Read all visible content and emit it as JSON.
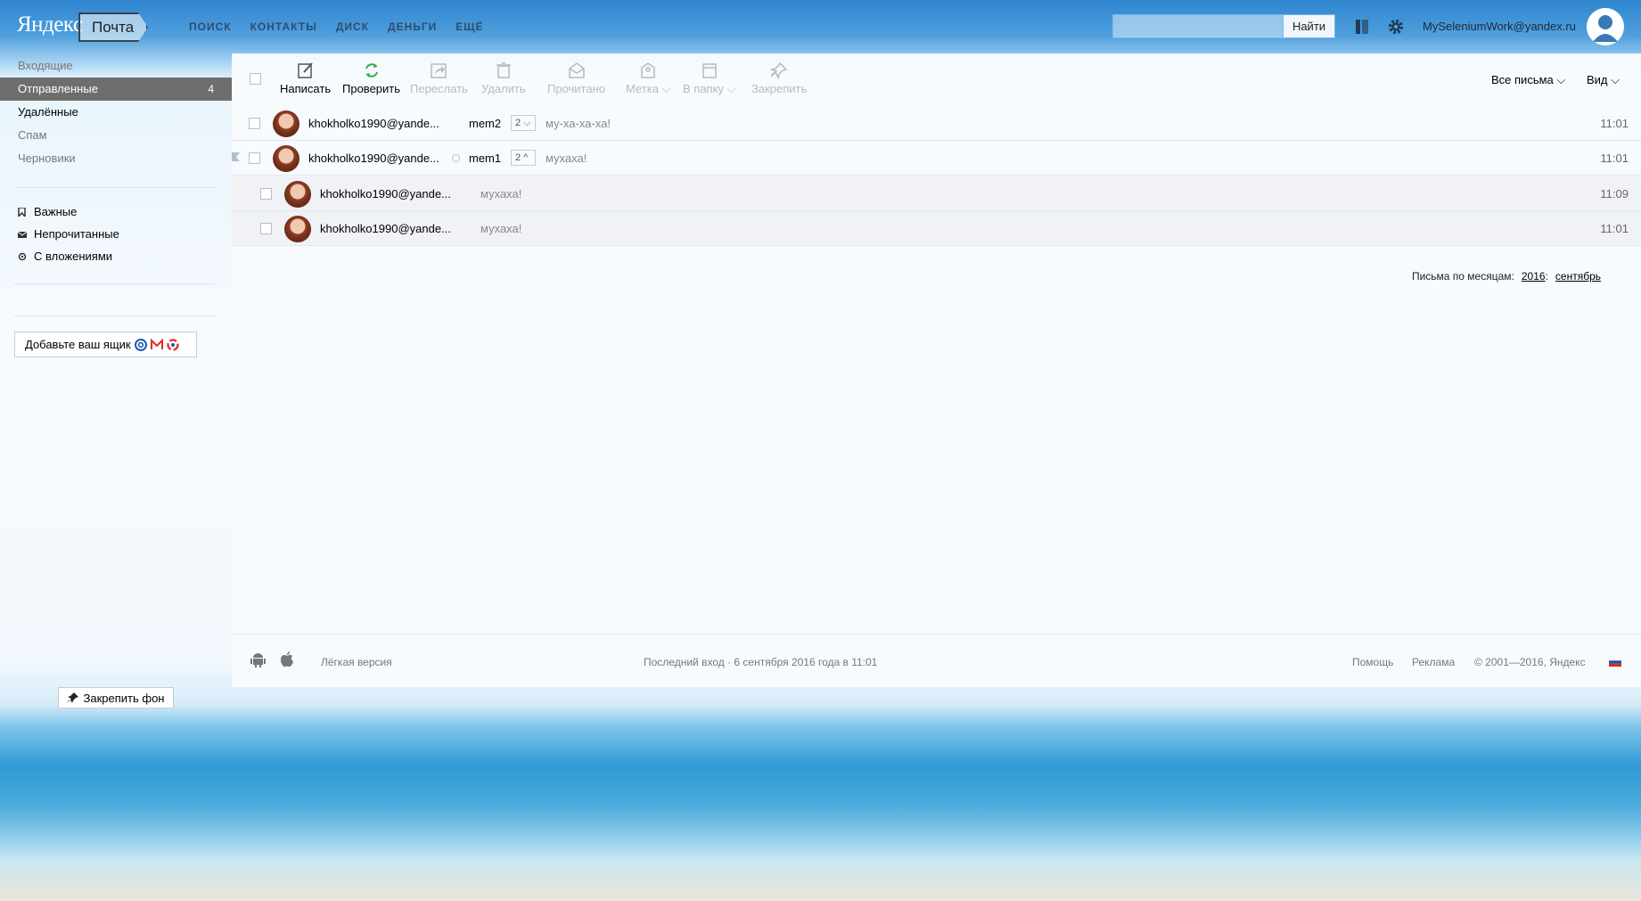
{
  "header": {
    "logo": "Яндекс",
    "mail_button": "Почта",
    "nav": [
      "ПОИСК",
      "КОНТАКТЫ",
      "ДИСК",
      "ДЕНЬГИ",
      "ЕЩЁ"
    ],
    "search_placeholder": "",
    "search_button": "Найти",
    "user_email": "MySeleniumWork@yandex.ru"
  },
  "sidebar": {
    "folders": [
      {
        "label": "Входящие",
        "count": ""
      },
      {
        "label": "Отправленные",
        "count": "4"
      },
      {
        "label": "Удалённые",
        "count": ""
      },
      {
        "label": "Спам",
        "count": ""
      },
      {
        "label": "Черновики",
        "count": ""
      }
    ],
    "labels": [
      {
        "label": "Важные",
        "icon": "bookmark-icon"
      },
      {
        "label": "Непрочитанные",
        "icon": "envelope-icon"
      },
      {
        "label": "С вложениями",
        "icon": "paperclip-icon"
      }
    ],
    "add_mailbox": "Добавьте ваш ящик",
    "pin_background": "Закрепить фон"
  },
  "toolbar": {
    "compose": "Написать",
    "check": "Проверить",
    "forward": "Переслать",
    "delete": "Удалить",
    "read": "Прочитано",
    "label": "Метка",
    "to_folder": "В папку",
    "pin": "Закрепить",
    "filter": "Все письма",
    "view": "Вид"
  },
  "messages": [
    {
      "from": "khokholko1990@yande...",
      "subject": "mem2",
      "count": "2",
      "snippet": "му-ха-ха-ха!",
      "time": "11:01"
    },
    {
      "from": "khokholko1990@yande...",
      "subject": "mem1",
      "count": "2",
      "snippet": "мухаха!",
      "time": "11:01"
    },
    {
      "from": "khokholko1990@yande...",
      "subject": "",
      "count": "",
      "snippet": "мухаха!",
      "time": "11:09"
    },
    {
      "from": "khokholko1990@yande...",
      "subject": "",
      "count": "",
      "snippet": "мухаха!",
      "time": "11:01"
    }
  ],
  "months": {
    "label": "Письма по месяцам:",
    "year": "2016",
    "colon": ":",
    "month": "сентябрь"
  },
  "footer": {
    "lite": "Лёгкая версия",
    "last_login": "Последний вход · 6 сентября 2016 года в 11:01",
    "help": "Помощь",
    "ads": "Реклама",
    "copyright": "© 2001—2016, Яндекс"
  },
  "colors": {
    "active_folder": "#6e6e6e",
    "accent_green": "#3aa84a",
    "header_blue": "#2f86cf"
  }
}
